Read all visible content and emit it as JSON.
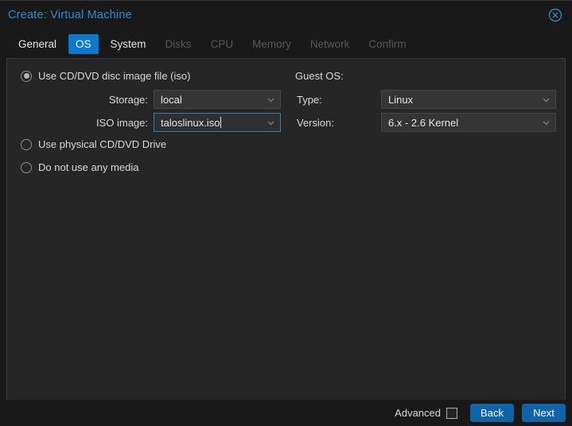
{
  "window": {
    "title": "Create: Virtual Machine"
  },
  "tabs": [
    {
      "label": "General",
      "state": "enabled"
    },
    {
      "label": "OS",
      "state": "active"
    },
    {
      "label": "System",
      "state": "enabled"
    },
    {
      "label": "Disks",
      "state": "disabled"
    },
    {
      "label": "CPU",
      "state": "disabled"
    },
    {
      "label": "Memory",
      "state": "disabled"
    },
    {
      "label": "Network",
      "state": "disabled"
    },
    {
      "label": "Confirm",
      "state": "disabled"
    }
  ],
  "form": {
    "media": {
      "radio_iso": {
        "label": "Use CD/DVD disc image file (iso)",
        "selected": true
      },
      "storage": {
        "label": "Storage:",
        "value": "local"
      },
      "iso_image": {
        "label": "ISO image:",
        "value": "taloslinux.iso",
        "focused": true
      },
      "radio_physical": {
        "label": "Use physical CD/DVD Drive",
        "selected": false
      },
      "radio_none": {
        "label": "Do not use any media",
        "selected": false
      }
    },
    "guest_os": {
      "section_label": "Guest OS:",
      "type": {
        "label": "Type:",
        "value": "Linux"
      },
      "version": {
        "label": "Version:",
        "value": "6.x - 2.6 Kernel"
      }
    }
  },
  "footer": {
    "advanced_label": "Advanced",
    "advanced_checked": false,
    "back_label": "Back",
    "next_label": "Next"
  },
  "colors": {
    "title_accent": "#2e8bd0",
    "tab_active_bg": "#0c79cf",
    "button_bg": "#0e64a6",
    "focused_field_border": "#2f7cba",
    "panel_bg": "#262626",
    "window_bg": "#191919"
  }
}
